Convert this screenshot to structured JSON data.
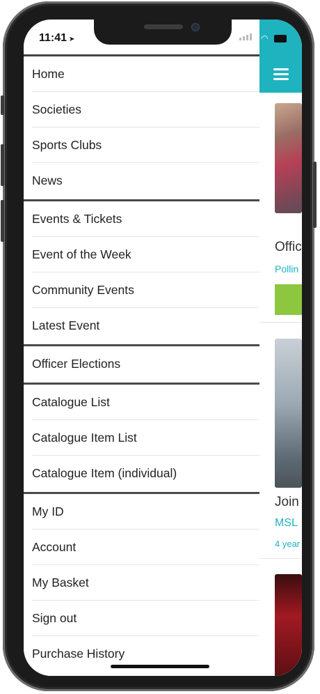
{
  "status_bar": {
    "time": "11:41"
  },
  "menu_groups": [
    [
      "Home",
      "Societies",
      "Sports Clubs",
      "News"
    ],
    [
      "Events & Tickets",
      "Event of the Week",
      "Community Events",
      "Latest Event"
    ],
    [
      "Officer Elections"
    ],
    [
      "Catalogue List",
      "Catalogue Item List",
      "Catalogue Item (individual)"
    ],
    [
      "My ID",
      "Account",
      "My Basket",
      "Sign out",
      "Purchase History"
    ]
  ],
  "background_cards": [
    {
      "title": "Offic",
      "link": "Pollin",
      "meta": ""
    },
    {
      "title": "Join",
      "link": "MSL",
      "meta": "4 year"
    }
  ],
  "colors": {
    "accent": "#1fb3c0",
    "green": "#8dc63f"
  },
  "icons": {
    "menu": "hamburger-icon",
    "location": "location-arrow-icon"
  }
}
